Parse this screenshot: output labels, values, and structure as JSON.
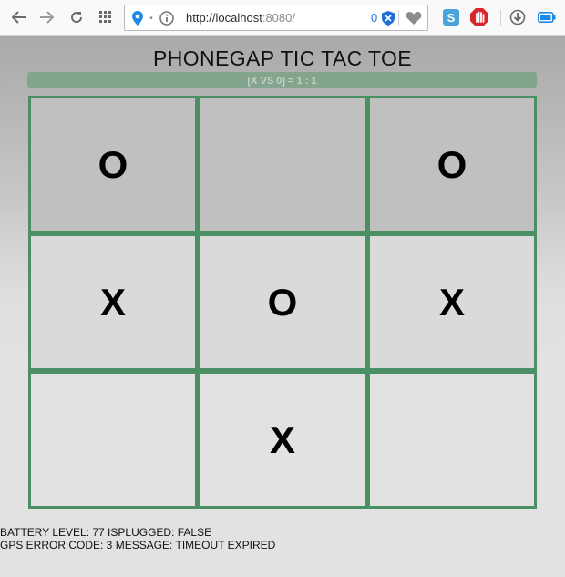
{
  "browser": {
    "url_host": "http://localhost",
    "url_rest": ":8080/",
    "tracker_count": "0",
    "icons": [
      "back-icon",
      "forward-icon",
      "reload-icon",
      "apps-grid-icon",
      "location-pin-icon",
      "info-icon",
      "shield-icon",
      "heart-icon",
      "skype-icon",
      "stop-hand-icon",
      "download-icon",
      "battery-icon"
    ]
  },
  "game": {
    "title": "PHONEGAP TIC TAC TOE",
    "score": "[X VS 0] = 1 : 1",
    "cells": [
      "O",
      "",
      "O",
      "X",
      "O",
      "X",
      "",
      "X",
      ""
    ]
  },
  "status": {
    "battery": "BATTERY LEVEL: 77 ISPLUGGED: FALSE",
    "gps": "GPS ERROR CODE: 3 MESSAGE: TIMEOUT EXPIRED"
  },
  "colors": {
    "board_border": "#4b8f64",
    "score_bar": "#83a48d"
  }
}
